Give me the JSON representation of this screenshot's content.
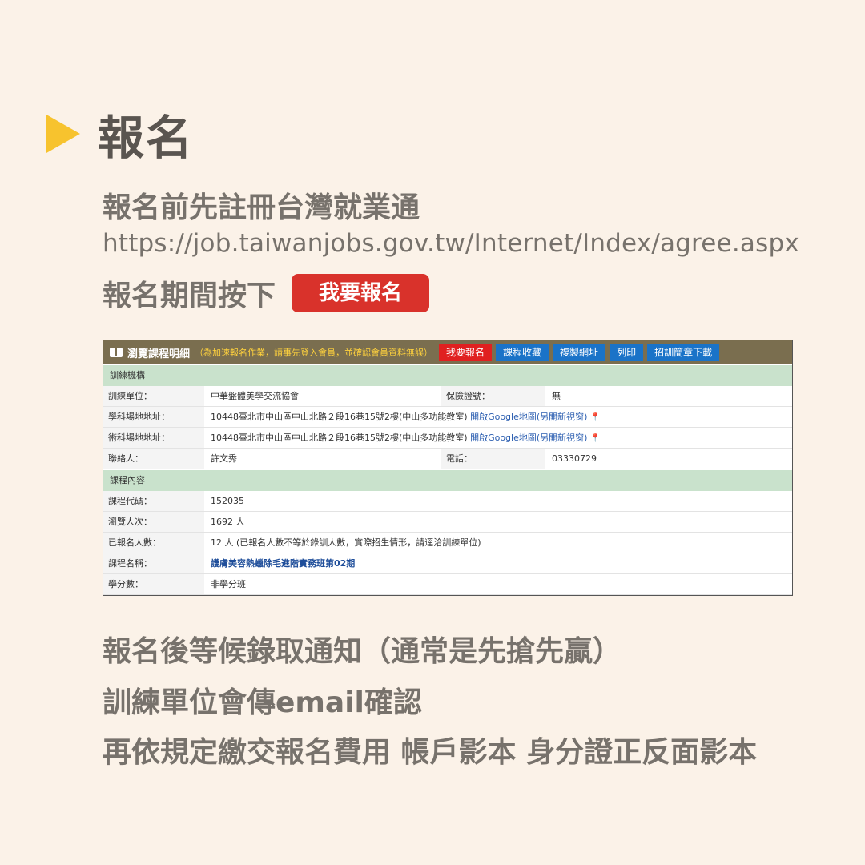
{
  "heading": "報名",
  "line1": "報名前先註冊台灣就業通",
  "url": "https://job.taiwanjobs.gov.tw/Internet/Index/agree.aspx",
  "line3_text": "報名期間按下",
  "register_button": "我要報名",
  "panel": {
    "title": "瀏覽課程明細",
    "note": "（為加速報名作業，請事先登入會員，並確認會員資料無誤）",
    "buttons": {
      "register": "我要報名",
      "favorite": "課程收藏",
      "copy_url": "複製網址",
      "print": "列印",
      "download": "招訓簡章下載"
    },
    "section1": "訓練機構",
    "org_label": "訓練單位：",
    "org_value": "中華盤體美學交流協會",
    "insurance_label": "保險證號：",
    "insurance_value": "無",
    "academic_label": "學科場地地址：",
    "academic_value": "10448臺北市中山區中山北路２段16巷15號2樓(中山多功能教室)",
    "technical_label": "術科場地地址：",
    "technical_value": "10448臺北市中山區中山北路２段16巷15號2樓(中山多功能教室)",
    "map_link": "開啟Google地圖(另開新視窗)",
    "contact_label": "聯絡人：",
    "contact_value": "許文秀",
    "phone_label": "電話：",
    "phone_value": "03330729",
    "section2": "課程內容",
    "code_label": "課程代碼：",
    "code_value": "152035",
    "views_label": "瀏覽人次：",
    "views_value": "1692 人",
    "registered_label": "已報名人數：",
    "registered_value": "12 人 (已報名人數不等於錄訓人數，實際招生情形，請逕洽訓練單位)",
    "name_label": "課程名稱：",
    "name_value": "護膚美容熱蠟除毛進階實務班第02期",
    "credits_label": "學分數：",
    "credits_value": "非學分班"
  },
  "bottom1": "報名後等候錄取通知（通常是先搶先贏）",
  "bottom2": "訓練單位會傳email確認",
  "bottom3": "再依規定繳交報名費用 帳戶影本 身分證正反面影本",
  "colors": {
    "background": "#fbf2e8",
    "accent_yellow": "#f7c32e",
    "button_red": "#d9322b"
  }
}
